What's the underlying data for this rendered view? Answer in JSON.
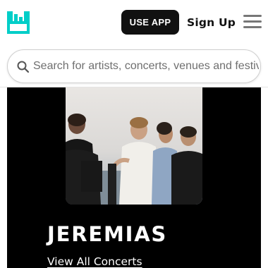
{
  "header": {
    "use_app_label": "USE APP",
    "signup_label": "Sign Up",
    "logo_icon": "bandsintown-logo-icon",
    "menu_icon": "hamburger-menu-icon"
  },
  "search": {
    "placeholder": "Search for artists, concerts, venues and festiv",
    "value": "",
    "icon": "search-icon"
  },
  "artist": {
    "name": "JEREMIAS",
    "view_all_label": "View All Concerts"
  },
  "colors": {
    "brand": "#00CEC8",
    "button_bg": "#111111",
    "hero_bg": "#000000"
  }
}
